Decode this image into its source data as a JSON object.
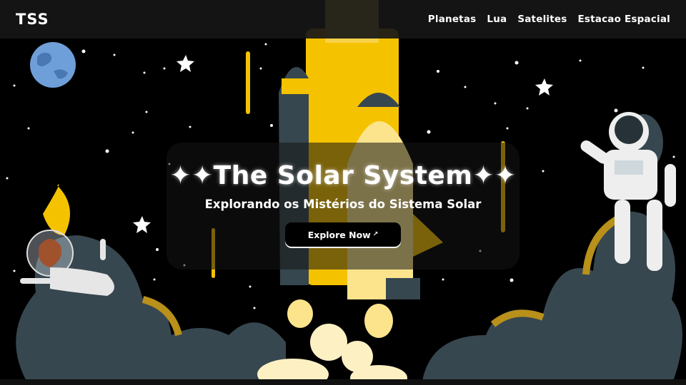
{
  "nav": {
    "logo": "TSS",
    "links": [
      "Planetas",
      "Lua",
      "Satelites",
      "Estacao Espacial"
    ]
  },
  "hero": {
    "title": "✦✦The Solar System✦✦",
    "subtitle": "Explorando os Mistérios do Sistema Solar",
    "cta_label": "Explore Now",
    "cta_icon": "↗"
  },
  "colors": {
    "background": "#000000",
    "accent_yellow": "#f5c200",
    "dark_gray": "#37474f",
    "planet_blue": "#6f9fd8"
  }
}
